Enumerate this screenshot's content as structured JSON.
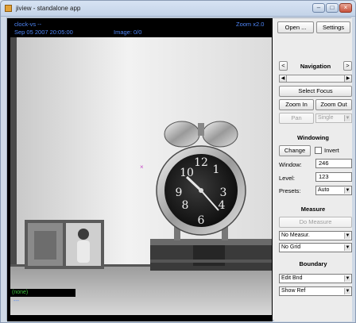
{
  "window": {
    "title": "jiview - standalone app",
    "minimize_symbol": "–",
    "maximize_symbol": "□",
    "close_symbol": "×"
  },
  "viewer": {
    "study_label": "clock-vs --",
    "date_time": "Sep 05 2007 20:05:00",
    "zoom_text": "Zoom x2.0",
    "image_text": "Image: 0/0",
    "overlay_text": "(none)",
    "bottom_text": "---",
    "cursor_symbol": "×"
  },
  "panel": {
    "open_label": "Open ...",
    "settings_label": "Settings",
    "nav_prev": "<",
    "nav_next": ">",
    "navigation_title": "Navigation",
    "scroll_left": "◀",
    "scroll_right": "▶",
    "select_focus_label": "Select Focus",
    "zoom_in_label": "Zoom In",
    "zoom_out_label": "Zoom Out",
    "pan_label": "Pan",
    "single_value": "Single",
    "windowing_title": "Windowing",
    "change_label": "Change",
    "invert_label": "Invert",
    "window_label": "Window:",
    "window_value": "246",
    "level_label": "Level:",
    "level_value": "123",
    "presets_label": "Presets:",
    "presets_value": "Auto",
    "measure_title": "Measure",
    "do_measure_label": "Do Measure",
    "measure_select": "No Measur.",
    "grid_select": "No Grid",
    "boundary_title": "Boundary",
    "edit_bnd_select": "Edit Bnd",
    "show_ref_select": "Show Ref",
    "dropdown_arrow": "▼"
  },
  "colors": {
    "overlay_text": "#4f86f7",
    "status_green": "#3ec13e",
    "cursor": "#c64bc6"
  }
}
